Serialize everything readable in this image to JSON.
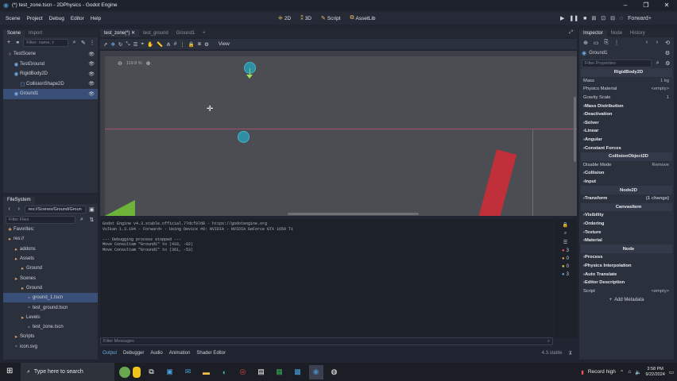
{
  "window": {
    "title": "(*) test_zone.tscn - 2DPhysics - Godot Engine",
    "controls": [
      "–",
      "❐",
      "✕"
    ]
  },
  "menu": [
    "Scene",
    "Project",
    "Debug",
    "Editor",
    "Help"
  ],
  "workspaces": [
    "2D",
    "3D",
    "Script",
    "AssetLib"
  ],
  "renderer": "Forward+",
  "scene_dock": {
    "tabs": [
      "Scene",
      "Import"
    ],
    "filter_placeholder": "Filter: name, t:",
    "nodes": [
      {
        "name": "TestScene",
        "indent": 0
      },
      {
        "name": "TestGround",
        "indent": 1
      },
      {
        "name": "RigidBody2D",
        "indent": 1
      },
      {
        "name": "CollisionShape2D",
        "indent": 2
      },
      {
        "name": "Ground1",
        "indent": 1
      }
    ]
  },
  "filesystem": {
    "title": "FileSystem",
    "path": "res://Scenes/Ground/Groun",
    "filter_placeholder": "Filter Files",
    "items": [
      {
        "name": "Favorites:",
        "indent": 0
      },
      {
        "name": "res://",
        "indent": 0
      },
      {
        "name": "addons",
        "indent": 1
      },
      {
        "name": "Assets",
        "indent": 1
      },
      {
        "name": "Ground",
        "indent": 2
      },
      {
        "name": "Scenes",
        "indent": 1
      },
      {
        "name": "Ground",
        "indent": 2
      },
      {
        "name": "ground_1.tscn",
        "indent": 3
      },
      {
        "name": "test_ground.tscn",
        "indent": 3
      },
      {
        "name": "Levels",
        "indent": 2
      },
      {
        "name": "test_zone.tscn",
        "indent": 3
      },
      {
        "name": "Scripts",
        "indent": 1
      },
      {
        "name": "icon.svg",
        "indent": 1
      }
    ]
  },
  "editor_tabs": [
    "test_zone(*)",
    "test_ground",
    "Ground1"
  ],
  "viewport": {
    "zoom": "119.9 %",
    "view_label": "View"
  },
  "output": {
    "lines": [
      "Godot Engine v4.3.stable.official.77dcf97d8 - https://godotengine.org",
      "Vulkan 1.3.194 - Forward+ - Using Device #0: NVIDIA - NVIDIA GeForce GTX 1650 Ti",
      "",
      "--- Debugging process stopped ---",
      "Move Consultam \"Ground1\" to (418, -82)",
      "Move Consultam \"Ground1\" to (361, -53)"
    ],
    "filter_placeholder": "Filter Messages",
    "bottom_tabs": [
      "Output",
      "Debugger",
      "Audio",
      "Animation",
      "Shader Editor"
    ],
    "version": "4.3.stable",
    "counts": [
      "3",
      "0",
      "0",
      "3"
    ]
  },
  "inspector": {
    "tabs": [
      "Inspector",
      "Node",
      "History"
    ],
    "object": "Ground1",
    "filter_placeholder": "Filter Properties",
    "rows": [
      {
        "label": "RigidBody2D",
        "kind": "cat",
        "value": ""
      },
      {
        "label": "Mass",
        "kind": "prop",
        "value": "1 kg"
      },
      {
        "label": "Physics Material",
        "kind": "prop",
        "value": "<empty>"
      },
      {
        "label": "Gravity Scale",
        "kind": "prop",
        "value": "1"
      },
      {
        "label": "Mass Distribution",
        "kind": "sect",
        "value": ""
      },
      {
        "label": "Deactivation",
        "kind": "sect",
        "value": ""
      },
      {
        "label": "Solver",
        "kind": "sect",
        "value": ""
      },
      {
        "label": "Linear",
        "kind": "sect",
        "value": ""
      },
      {
        "label": "Angular",
        "kind": "sect",
        "value": ""
      },
      {
        "label": "Constant Forces",
        "kind": "sect",
        "value": ""
      },
      {
        "label": "CollisionObject2D",
        "kind": "cat",
        "value": ""
      },
      {
        "label": "Disable Mode",
        "kind": "prop",
        "value": "Remove"
      },
      {
        "label": "Collision",
        "kind": "sect",
        "value": ""
      },
      {
        "label": "Input",
        "kind": "sect",
        "value": ""
      },
      {
        "label": "Node2D",
        "kind": "cat",
        "value": ""
      },
      {
        "label": "Transform",
        "kind": "sect",
        "value": "(1 change)"
      },
      {
        "label": "CanvasItem",
        "kind": "cat",
        "value": ""
      },
      {
        "label": "Visibility",
        "kind": "sect",
        "value": ""
      },
      {
        "label": "Ordering",
        "kind": "sect",
        "value": ""
      },
      {
        "label": "Texture",
        "kind": "sect",
        "value": ""
      },
      {
        "label": "Material",
        "kind": "sect",
        "value": ""
      },
      {
        "label": "Node",
        "kind": "cat",
        "value": ""
      },
      {
        "label": "Process",
        "kind": "sect",
        "value": ""
      },
      {
        "label": "Physics Interpolation",
        "kind": "sect",
        "value": ""
      },
      {
        "label": "Auto Translate",
        "kind": "sect",
        "value": ""
      },
      {
        "label": "Editor Description",
        "kind": "sect",
        "value": ""
      },
      {
        "label": "Script",
        "kind": "prop",
        "value": "<empty>"
      }
    ],
    "add_metadata": "Add Metadata"
  },
  "taskbar": {
    "search_placeholder": "Type here to search",
    "record": "Record high",
    "time": "3:58 PM",
    "date": "9/22/2024"
  },
  "colors": {
    "accent": "#478cbf",
    "selection": "#3a4f78",
    "ground_green": "#6db33a",
    "ground_red": "#c0303a"
  }
}
